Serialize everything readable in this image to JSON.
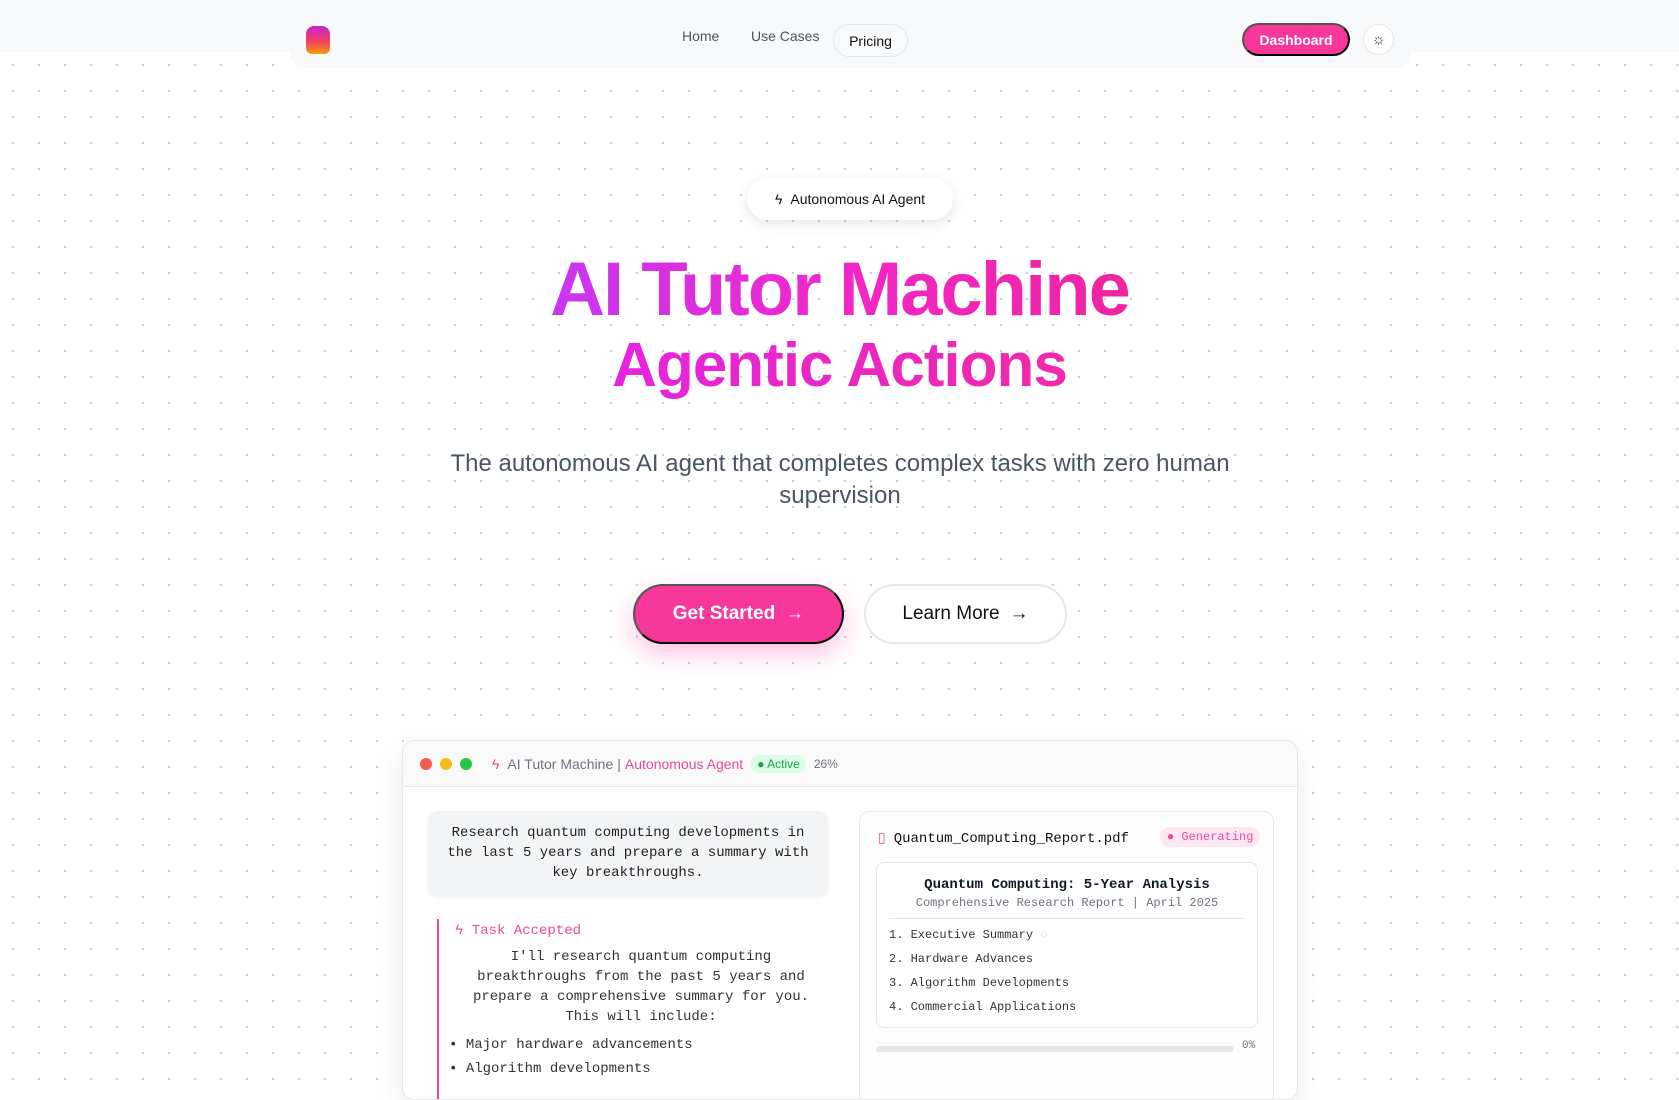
{
  "nav": {
    "links": [
      "Home",
      "Use Cases"
    ],
    "active": "Pricing",
    "dashboard": "Dashboard"
  },
  "hero": {
    "badge": "Autonomous AI Agent",
    "title": "AI Tutor Machine",
    "subtitle_title": "Agentic Actions",
    "description": "The autonomous AI agent that completes complex tasks with zero human supervision",
    "get_started": "Get Started",
    "learn_more": "Learn More"
  },
  "window": {
    "app": "AI Tutor Machine",
    "sep": "|",
    "mode": "Autonomous Agent",
    "status": "Active",
    "progress": "26%",
    "prompt": "Research quantum computing developments in the last 5 years and prepare a summary with key breakthroughs.",
    "task_title": "Task Accepted",
    "task_text": "I'll research quantum computing breakthroughs from the past 5 years and prepare a comprehensive summary for you. This will include:",
    "task_items": [
      "Major hardware advancements",
      "Algorithm developments"
    ],
    "file": {
      "name": "Quantum_Computing_Report.pdf",
      "status": "Generating",
      "doc_title": "Quantum Computing: 5-Year Analysis",
      "doc_subtitle": "Comprehensive Research Report | April 2025",
      "sections": [
        "1. Executive Summary",
        "2. Hardware Advances",
        "3. Algorithm Developments",
        "4. Commercial Applications"
      ],
      "progress": "0%"
    }
  },
  "colors": {
    "accent": "#f7379a",
    "green": "#16a34a"
  }
}
